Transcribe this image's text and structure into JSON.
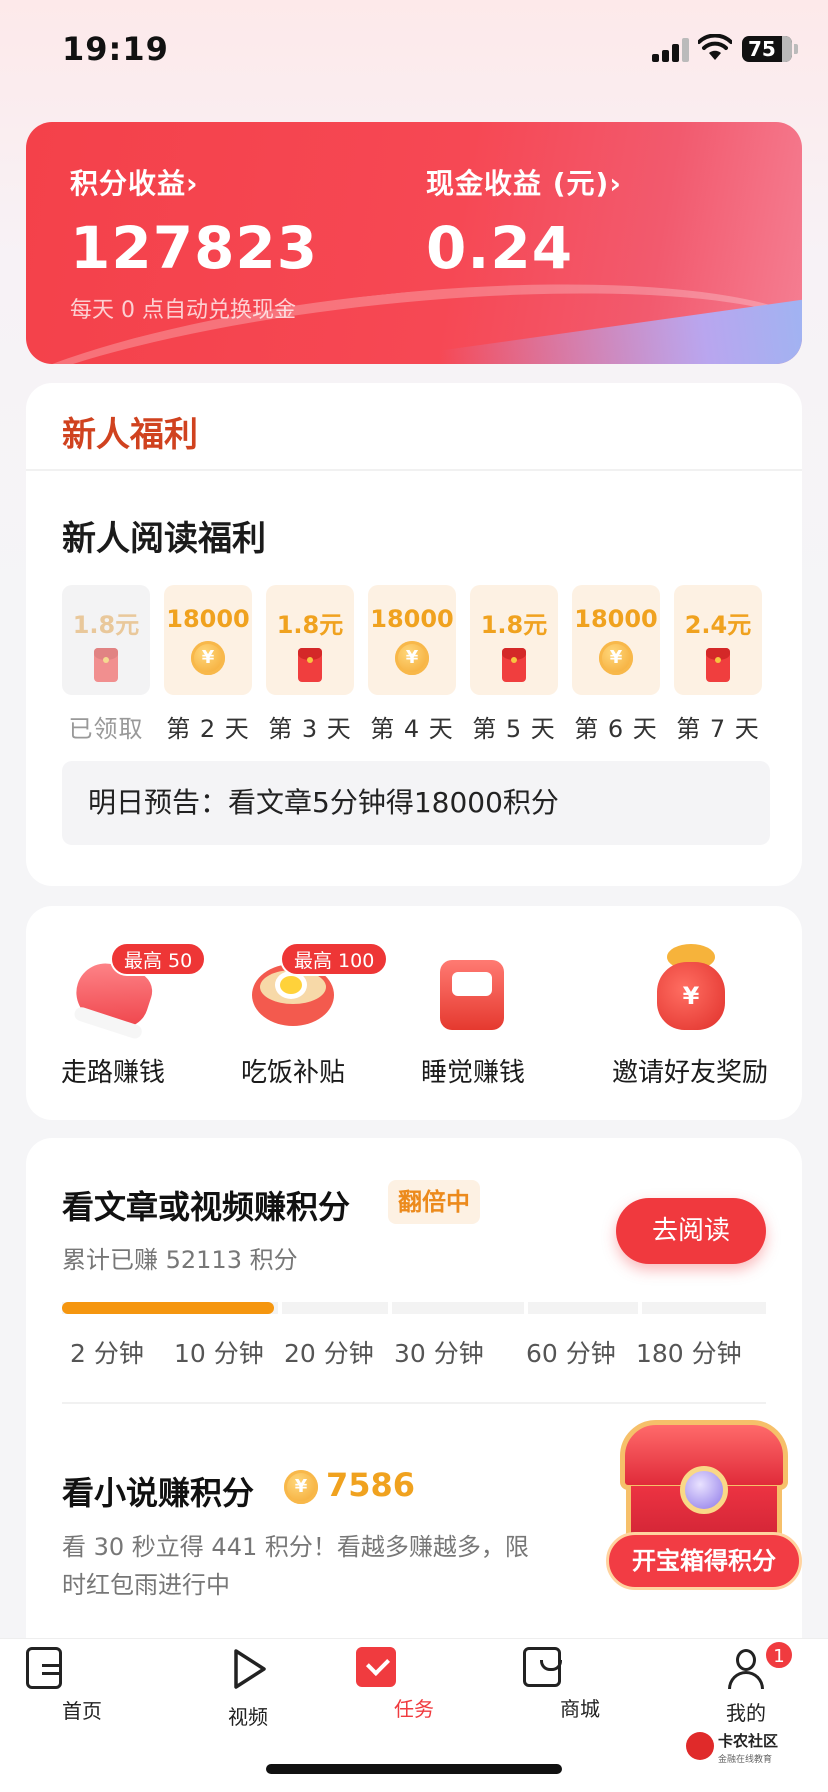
{
  "status_bar": {
    "time": "19:19",
    "battery": "75"
  },
  "earnings": {
    "points_label": "积分收益",
    "points_value": "127823",
    "cash_label": "现金收益 (元)",
    "cash_value": "0.24",
    "note": "每天 0 点自动兑换现金",
    "chevron": "›",
    "colors": {
      "card_start": "#f4414a",
      "card_end": "#f57f93"
    }
  },
  "newcomer": {
    "title": "新人福利",
    "section_heading": "新人阅读福利",
    "days": [
      {
        "value": "1.8元",
        "icon": "red-envelope-icon",
        "label": "已领取",
        "claimed": true
      },
      {
        "value": "18000",
        "icon": "coin-icon",
        "label": "第 2 天",
        "claimed": false
      },
      {
        "value": "1.8元",
        "icon": "red-envelope-icon",
        "label": "第 3 天",
        "claimed": false
      },
      {
        "value": "18000",
        "icon": "coin-icon",
        "label": "第 4 天",
        "claimed": false
      },
      {
        "value": "1.8元",
        "icon": "red-envelope-icon",
        "label": "第 5 天",
        "claimed": false
      },
      {
        "value": "18000",
        "icon": "coin-icon",
        "label": "第 6 天",
        "claimed": false
      },
      {
        "value": "2.4元",
        "icon": "red-envelope-icon",
        "label": "第 7 天",
        "claimed": false
      }
    ],
    "notice": "明日预告：看文章5分钟得18000积分"
  },
  "quick_actions": [
    {
      "label": "走路赚钱",
      "badge": "最高 50",
      "icon": "sneaker-icon"
    },
    {
      "label": "吃饭补贴",
      "badge": "最高 100",
      "icon": "noodle-bowl-icon"
    },
    {
      "label": "睡觉赚钱",
      "badge": "",
      "icon": "pillow-icon"
    },
    {
      "label": "邀请好友奖励",
      "badge": "",
      "icon": "money-pouch-icon"
    }
  ],
  "reading_task": {
    "title": "看文章或视频赚积分",
    "tag": "翻倍中",
    "subtitle": "累计已赚 52113 积分",
    "button": "去阅读",
    "progress_completed_segments": 2,
    "milestones": [
      "2 分钟",
      "10 分钟",
      "20 分钟",
      "30 分钟",
      "60 分钟",
      "180 分钟"
    ],
    "colors": {
      "progress": "#f5960f",
      "button": "#f0393e"
    }
  },
  "novel_task": {
    "title": "看小说赚积分",
    "coin_symbol": "¥",
    "points": "7586",
    "description": "看 30 秒立得 441 积分！看越多赚越多，限时红包雨进行中"
  },
  "treasure": {
    "button": "开宝箱得积分",
    "icon": "treasure-chest-icon"
  },
  "tab_bar": {
    "tabs": [
      {
        "label": "首页",
        "icon": "document-icon",
        "active": false
      },
      {
        "label": "视频",
        "icon": "play-icon",
        "active": false
      },
      {
        "label": "任务",
        "icon": "task-check-icon",
        "active": true
      },
      {
        "label": "商城",
        "icon": "shopping-bag-icon",
        "active": false
      },
      {
        "label": "我的",
        "icon": "user-icon",
        "active": false
      }
    ],
    "profile_badge": "1",
    "active_color": "#f03b3f"
  },
  "watermark": {
    "title": "卡农社区",
    "subtitle": "金融在线教育"
  }
}
